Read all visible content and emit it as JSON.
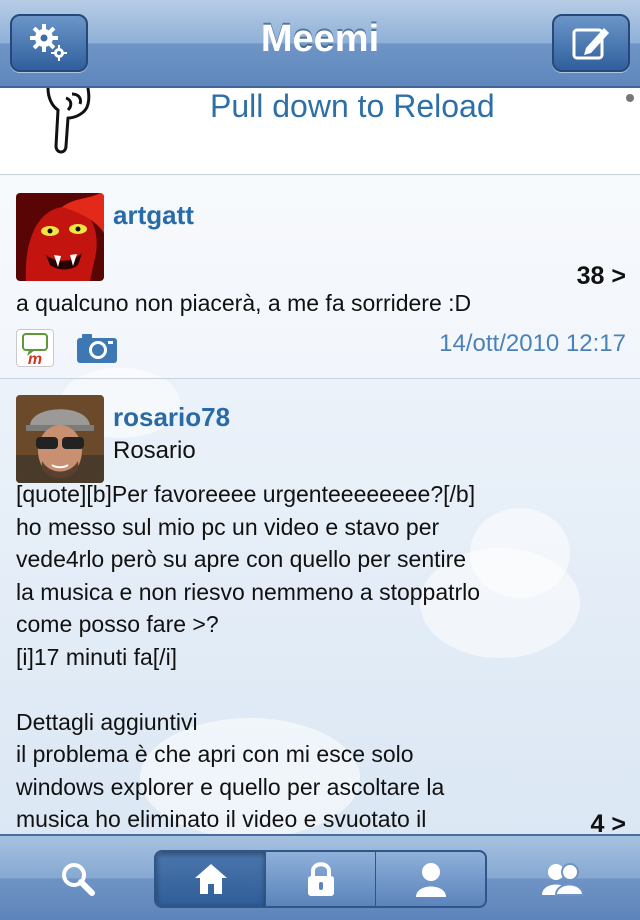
{
  "navbar": {
    "title": "Meemi",
    "left_icon": "gear-icon",
    "right_icon": "compose-icon"
  },
  "reload": {
    "label": "Pull down to Reload",
    "icon": "pointing-hand-icon"
  },
  "posts": [
    {
      "username": "artgatt",
      "real_name": "",
      "message": "a qualcuno non piacerà, a me fa sorridere :D",
      "count": "38 >",
      "date": "14/ott/2010 12:17",
      "icons": [
        "meemi-icon",
        "camera-icon"
      ]
    },
    {
      "username": "rosario78",
      "real_name": "Rosario",
      "message": "[quote][b]Per favoreeee urgenteeeeeeee?[/b]\nho messo sul mio pc un video e stavo per\nvede4rlo però su apre con quello per sentire\nla musica e non riesvo nemmeno a stoppatrlo\ncome posso fare >?\n[i]17 minuti fa[/i]\n\nDettagli aggiuntivi\nil problema è che apri con mi esce solo\nwindows explorer e quello per ascoltare la\nmusica ho eliminato il video e svuotato il",
      "count": "4 >"
    }
  ],
  "tabbar": {
    "items": [
      "search-icon",
      "home-icon",
      "lock-icon",
      "user-icon",
      "users-icon"
    ],
    "active": "home-icon"
  },
  "colors": {
    "accent": "#2a6aa6",
    "date": "#4a82b8",
    "navbar": "#6f95c6"
  }
}
